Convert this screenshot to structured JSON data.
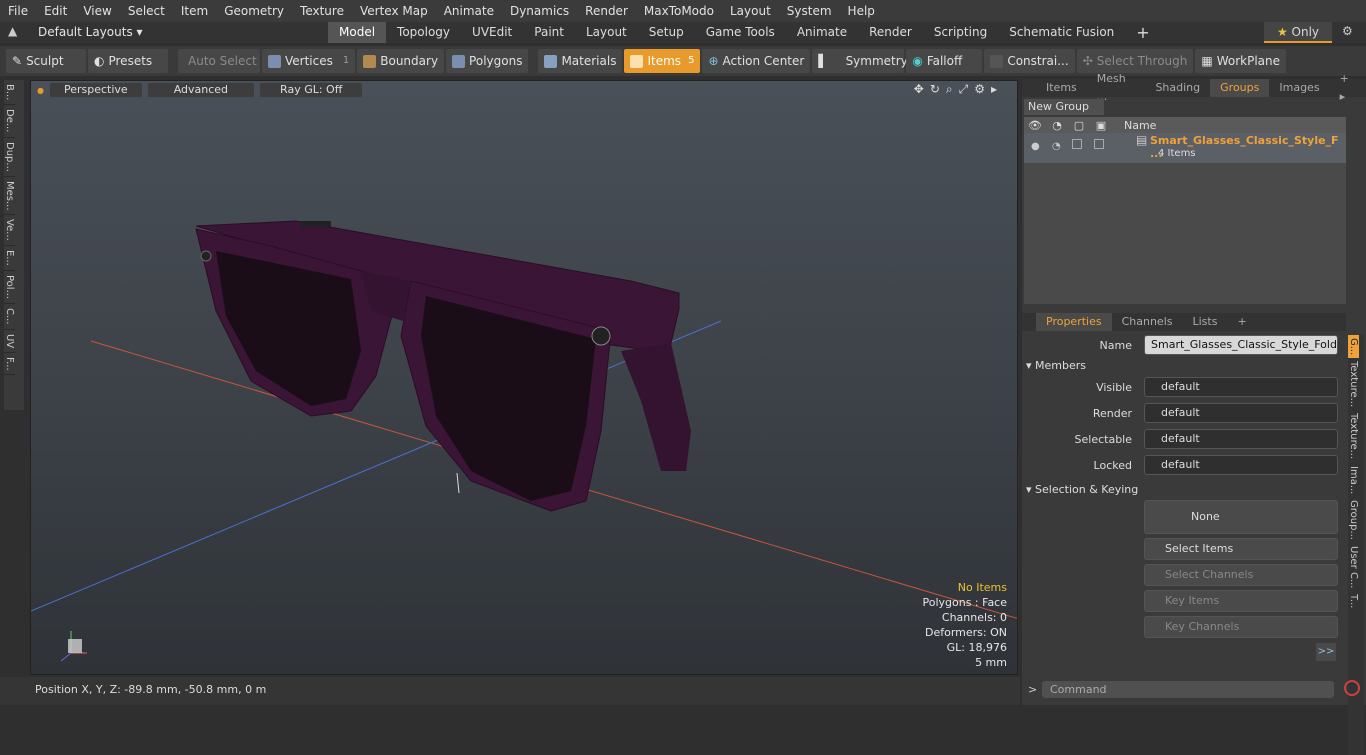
{
  "menu": [
    "File",
    "Edit",
    "View",
    "Select",
    "Item",
    "Geometry",
    "Texture",
    "Vertex Map",
    "Animate",
    "Dynamics",
    "Render",
    "MaxToModo",
    "Layout",
    "System",
    "Help"
  ],
  "layout_select": "Default Layouts",
  "tabs": [
    "Model",
    "Topology",
    "UVEdit",
    "Paint",
    "Layout",
    "Setup",
    "Game Tools",
    "Animate",
    "Render",
    "Scripting",
    "Schematic Fusion"
  ],
  "only_label": "Only",
  "toolbar": {
    "sculpt": "Sculpt",
    "presets": "Presets",
    "auto_select": "Auto Select",
    "vertices": "Vertices",
    "vertices_count": "1",
    "boundary": "Boundary",
    "polygons": "Polygons",
    "materials": "Materials",
    "items": "Items",
    "items_count": "5",
    "action_center": "Action Center",
    "symmetry": "Symmetry",
    "falloff": "Falloff",
    "constraints": "Constrai...",
    "select_through": "Select Through",
    "workplane": "WorkPlane"
  },
  "left_tabs": [
    "B...",
    "De...",
    "Dup...",
    "Mes...",
    "Ve...",
    "E...",
    "Pol...",
    "C...",
    "UV",
    "F..."
  ],
  "viewport": {
    "perspective": "Perspective",
    "advanced": "Advanced",
    "raygl": "Ray GL: Off",
    "info": {
      "no_items": "No Items",
      "polygons": "Polygons : Face",
      "channels": "Channels: 0",
      "deformers": "Deformers: ON",
      "gl": "GL: 18,976",
      "scale": "5 mm"
    }
  },
  "status": "Position X, Y, Z:  -89.8 mm, -50.8 mm, 0 m",
  "panel_tabs": [
    "Items",
    "Mesh ...",
    "Shading",
    "Groups",
    "Images"
  ],
  "new_group": "New Group",
  "name_header": "Name",
  "group": {
    "name": "Smart_Glasses_Classic_Style_F ...",
    "count": "4 Items"
  },
  "prop_tabs": [
    "Properties",
    "Channels",
    "Lists"
  ],
  "props": {
    "name_label": "Name",
    "name_value": "Smart_Glasses_Classic_Style_Folded (",
    "members": "Members",
    "visible": "Visible",
    "render": "Render",
    "selectable": "Selectable",
    "locked": "Locked",
    "default": "default",
    "sel_keying": "Selection & Keying",
    "none": "None",
    "select_items": "Select Items",
    "select_channels": "Select Channels",
    "key_items": "Key Items",
    "key_channels": "Key Channels",
    "more": ">>"
  },
  "right_tabs": [
    "G...",
    "Texture...",
    "Texture...",
    "Ima...",
    "Group...",
    "User C...",
    "T..."
  ],
  "command_placeholder": "Command",
  "colors": {
    "accent": "#e89a2a",
    "glasses": "#3b1535"
  }
}
